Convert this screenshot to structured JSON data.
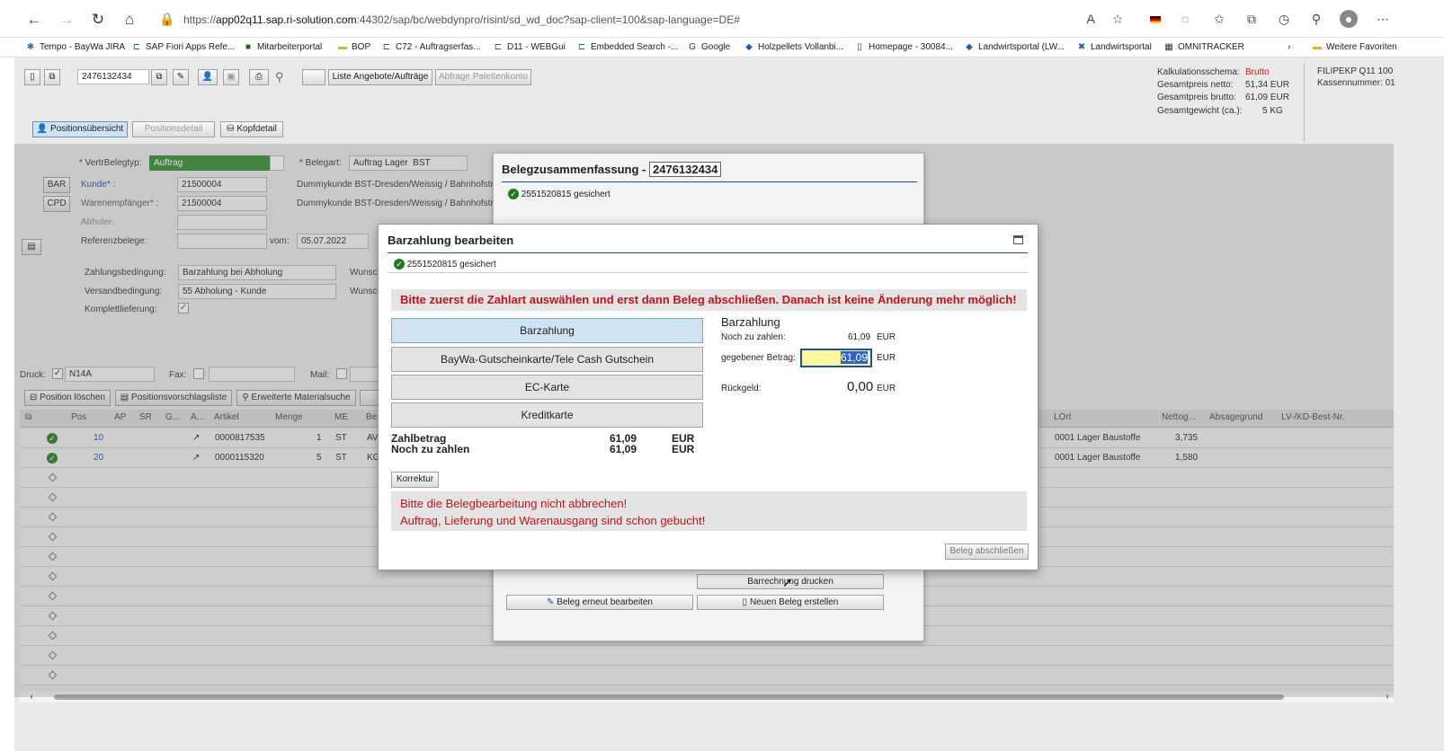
{
  "browser": {
    "url_prefix": "https://",
    "url_host": "app02q11.sap.ri-solution.com",
    "url_rest": ":44302/sap/bc/webdynpro/risint/sd_wd_doc?sap-client=100&sap-language=DE#"
  },
  "favorites": [
    "Tempo - BayWa JIRA",
    "SAP Fiori Apps Refe...",
    "Mitarbeiterportal",
    "BOP",
    "C72 - Auftragserfas...",
    "D11 - WEBGui",
    "Embedded Search -...",
    "Google",
    "Holzpellets Vollanbi...",
    "Homepage - 30084...",
    "Landwirtsportal (LW...",
    "Landwirtsportal",
    "OMNITRACKER",
    "Weitere Favoriten"
  ],
  "toolbar": {
    "doc_number": "2476132434",
    "btn_list": "Liste Angebote/Aufträge",
    "btn_pallet": "Abfrage Palettenkonto"
  },
  "tabs": {
    "overview": "Positionsübersicht",
    "detail": "Positionsdetail",
    "header": "Kopfdetail"
  },
  "totals": {
    "scheme_label": "Kalkulationsschema:",
    "scheme_value": "Brutto",
    "net_label": "Gesamtpreis netto:",
    "net_value": "51,34 EUR",
    "gross_label": "Gesamtpreis brutto:",
    "gross_value": "61,09 EUR",
    "weight_label": "Gesamtgewicht (ca.):",
    "weight_value": "5 KG",
    "branch": "FILIPEKP Q11 100",
    "register": "Kassennummer: 01"
  },
  "form": {
    "vertrbelegtyp_label": "* VertrBelegtyp:",
    "vertrbelegtyp": "Auftrag",
    "belegart_label": "* Belegart:",
    "belegart": "Auftrag Lager",
    "belegart_code": "BST",
    "bar": "BAR",
    "cpd": "CPD",
    "kunde_label": "Kunde* :",
    "kunde": "21500004",
    "kunde_name": "Dummykunde BST-Dresden/Weissig / Bahnhofstr.",
    "waren_label": "Warenempfänger* :",
    "waren": "21500004",
    "waren_name": "Dummykunde BST-Dresden/Weissig / Bahnhofstr.",
    "abholer_label": "Abholer:",
    "ref_label": "Referenzbelege:",
    "vom_label": "vom:",
    "vom": "05.07.2022",
    "zahl_label": "Zahlungsbedingung:",
    "zahl": "Barzahlung bei Abholung",
    "wunsch1": "Wunsc",
    "versand_label": "Versandbedingung:",
    "versand": "55 Abholung - Kunde",
    "wunsch2": "Wunsc",
    "komplett_label": "Komplettlieferung:",
    "druck_label": "Druck:",
    "druck": "N14A",
    "fax_label": "Fax:",
    "mail_label": "Mail:"
  },
  "grid": {
    "btn_delete": "Position löschen",
    "btn_suggest": "Positionsvorschlagsliste",
    "btn_search": "Erweiterte Materialsuche",
    "headers": [
      "Pos",
      "AP",
      "SR",
      "G...",
      "A...",
      "Artikel",
      "Menge",
      "ME",
      "Be",
      "LOrt",
      "Nettog...",
      "Absagegrund",
      "LV-/KD-Best-Nr."
    ],
    "rows": [
      {
        "pos": "10",
        "artikel": "0000817535",
        "menge": "1",
        "me": "ST",
        "be": "AV",
        "lort": "0001 Lager Baustoffe",
        "netto": "3,735"
      },
      {
        "pos": "20",
        "artikel": "0000115320",
        "menge": "5",
        "me": "ST",
        "be": "KG",
        "lort": "0001 Lager Baustoffe",
        "netto": "1,580"
      }
    ]
  },
  "summary": {
    "title": "Belegzusammenfassung -",
    "doc": "2476132434",
    "saved": "2551520815  gesichert",
    "btn_print": "Barrechnung drucken",
    "btn_edit": "Beleg erneut bearbeiten",
    "btn_new": "Neuen Beleg erstellen"
  },
  "dialog": {
    "title": "Barzahlung bearbeiten",
    "saved": "2551520815  gesichert",
    "warning_top": "Bitte zuerst die Zahlart auswählen und erst dann Beleg abschließen. Danach ist keine Änderung mehr möglich!",
    "methods": [
      "Barzahlung",
      "BayWa-Gutscheinkarte/Tele Cash Gutschein",
      "EC-Karte",
      "Kreditkarte"
    ],
    "selected_method": "Barzahlung",
    "due_label": "Noch zu zahlen:",
    "due_value": "61,09",
    "currency": "EUR",
    "given_label": "gegebener Betrag:",
    "given_value": "61,09",
    "change_label": "Rückgeld:",
    "change_value": "0,00",
    "zahlbetrag_label": "Zahlbetrag",
    "zahlbetrag": "61,09",
    "noch_label": "Noch zu zahlen",
    "noch": "61,09",
    "korrektur": "Korrektur",
    "warning_b1": "Bitte die Belegbearbeitung nicht abbrechen!",
    "warning_b2": "Auftrag, Lieferung und Warenausgang sind schon gebucht!",
    "btn_close": "Beleg abschließen"
  }
}
